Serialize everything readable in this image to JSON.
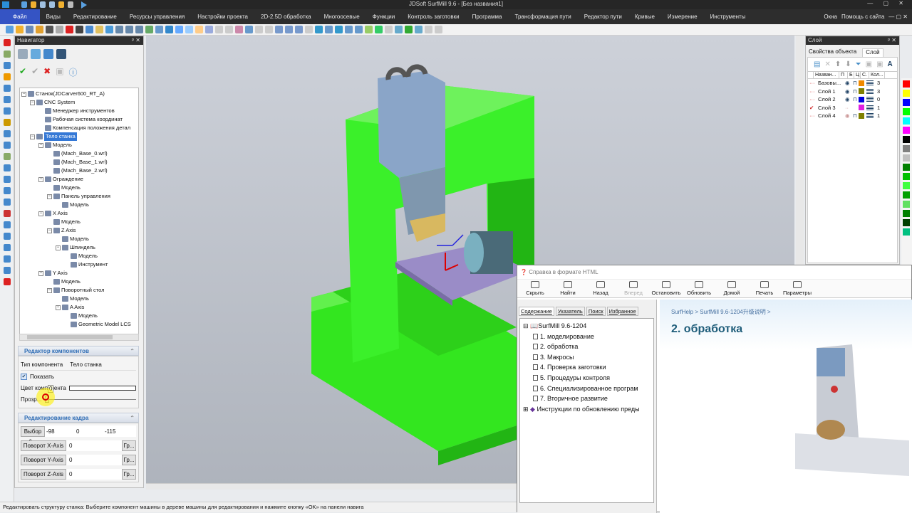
{
  "title": "JDSoft SurfMill 9.6 - [Без названия1]",
  "menu": [
    "Файл",
    "Виды",
    "Редактирование",
    "Ресурсы управления",
    "Настройки проекта",
    "2D-2.5D обработка",
    "Многоосевые",
    "Функции",
    "Контроль заготовки",
    "Программа",
    "Трансформация пути",
    "Редактор пути",
    "Кривые",
    "Измерение",
    "Инструменты"
  ],
  "menu_right": {
    "windows": "Окна",
    "help": "Помощь с сайта"
  },
  "navigator": {
    "title": "Навигатор",
    "tree": [
      [
        0,
        "Станок(JDCarver600_RT_A)"
      ],
      [
        1,
        "CNC System"
      ],
      [
        2,
        "Менеджер инструментов"
      ],
      [
        2,
        "Рабочая система координат"
      ],
      [
        2,
        "Компенсация положения детал"
      ],
      [
        1,
        "Тело станка"
      ],
      [
        2,
        "Модель"
      ],
      [
        3,
        "(Mach_Base_0.wrl)"
      ],
      [
        3,
        "(Mach_Base_1.wrl)"
      ],
      [
        3,
        "(Mach_Base_2.wrl)"
      ],
      [
        2,
        "Ограждение"
      ],
      [
        3,
        "Модель"
      ],
      [
        3,
        "Панель управления"
      ],
      [
        4,
        "Модель"
      ],
      [
        2,
        "X Axis"
      ],
      [
        3,
        "Модель"
      ],
      [
        3,
        "Z Axis"
      ],
      [
        4,
        "Модель"
      ],
      [
        4,
        "Шпиндель"
      ],
      [
        5,
        "Модель"
      ],
      [
        5,
        "Инструмент"
      ],
      [
        2,
        "Y Axis"
      ],
      [
        3,
        "Модель"
      ],
      [
        3,
        "Поворотный стол"
      ],
      [
        4,
        "Модель"
      ],
      [
        4,
        "A Axis"
      ],
      [
        5,
        "Модель"
      ],
      [
        5,
        "Geometric Model LCS"
      ]
    ],
    "selected_index": 5,
    "component_editor": {
      "title": "Редактор компонентов",
      "type_label": "Тип компонента",
      "type_value": "Тело станка",
      "show_label": "Показать",
      "show_checked": true,
      "color_label": "Цвет компонента",
      "transparency_label": "Прозр...",
      "transparency_value": "0",
      "transparency_fraction": 0
    },
    "frame_editor": {
      "title": "Редактирование кадра",
      "select_label": "Выбор с...",
      "x": "-98",
      "y": "0",
      "z": "-115",
      "rotations": [
        {
          "label": "Поворот X-Axis",
          "value": "0",
          "unit": "Гр..."
        },
        {
          "label": "Поворот Y-Axis",
          "value": "0",
          "unit": "Гр..."
        },
        {
          "label": "Поворот Z-Axis",
          "value": "0",
          "unit": "Гр..."
        }
      ]
    }
  },
  "layer_panel": {
    "title": "Слой",
    "tabs": [
      "Свойства объекта",
      "Слой"
    ],
    "active_tab": 1,
    "columns": [
      "Назван...",
      "П",
      "Б",
      "Ц",
      "С.",
      "Кол..."
    ],
    "rows": [
      {
        "name": "Базовы...",
        "color": "#f08a00",
        "count": "3",
        "visible": true,
        "current": false
      },
      {
        "name": "Слой 1",
        "color": "#808000",
        "count": "3",
        "visible": true,
        "current": false
      },
      {
        "name": "Слой 2",
        "color": "#0000e0",
        "count": "0",
        "visible": true,
        "current": false
      },
      {
        "name": "Слой 3",
        "color": "#e020e0",
        "count": "1",
        "visible": false,
        "current": true
      },
      {
        "name": "Слой 4",
        "color": "#808000",
        "count": "1",
        "visible": false,
        "current": false
      }
    ]
  },
  "palette": [
    "#ff0000",
    "#ffff00",
    "#0000ff",
    "#00ff00",
    "#00ffff",
    "#ff00ff",
    "#000000",
    "#808080",
    "#c0c0c0",
    "#008000",
    "#00c000",
    "#40ff40",
    "#00a000",
    "#60e060",
    "#008000",
    "#004000",
    "#00c080"
  ],
  "help": {
    "title": "Справка в формате HTML",
    "buttons": [
      "Скрыть",
      "Найти",
      "Назад",
      "Вперед",
      "Остановить",
      "Обновить",
      "Домой",
      "Печать",
      "Параметры"
    ],
    "tabs": [
      "Содержание",
      "Указатель",
      "Поиск",
      "Избранное"
    ],
    "root": "SurfMill 9.6-1204",
    "items": [
      "1. моделирование",
      "2. обработка",
      "3. Макросы",
      "4. Проверка заготовки",
      "5. Процедуры контроля",
      "6. Специализированное програм",
      "7. Вторичное развитие"
    ],
    "other": "Инструкции по обновлению преды",
    "breadcrumb": "SurfHelp > SurfMill 9.6-1204升级说明 >",
    "heading": "2. обработка"
  },
  "status": "Редактировать структуру станка: Выберите компонент машины в дереве машины для редактирования и нажмите кнопку «OK» на панели навига"
}
